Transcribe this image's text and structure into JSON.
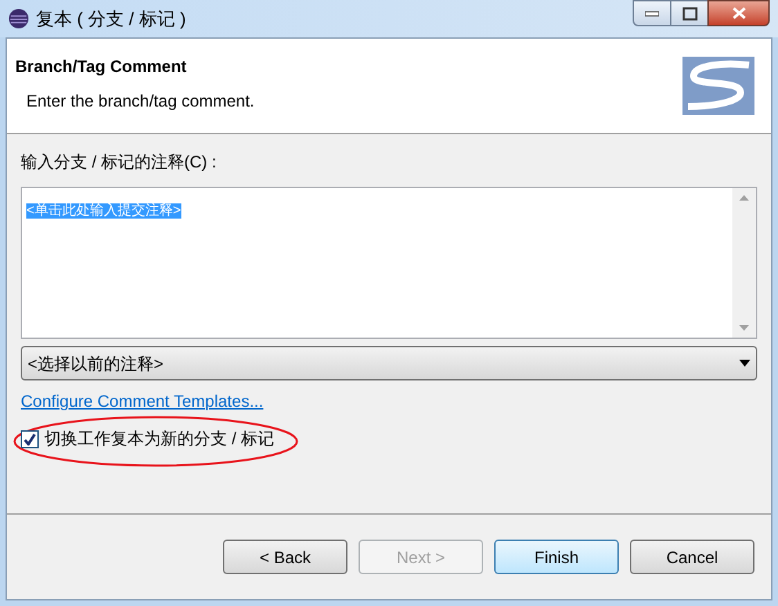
{
  "window": {
    "title": "复本 ( 分支 / 标记 )"
  },
  "header": {
    "title": "Branch/Tag Comment",
    "description": "Enter the branch/tag comment."
  },
  "comment": {
    "label": "输入分支 / 标记的注释(C) :",
    "value": "<单击此处输入提交注释>"
  },
  "previous_comments": {
    "value": "<选择以前的注释>"
  },
  "link": "Configure Comment Templates...",
  "switch_checkbox": {
    "label": "切换工作复本为新的分支 / 标记",
    "checked": true,
    "highlighted": true
  },
  "buttons": [
    {
      "label": "< Back",
      "disabled": false,
      "default": false
    },
    {
      "label": "Next >",
      "disabled": true,
      "default": false
    },
    {
      "label": "Finish",
      "disabled": false,
      "default": true
    },
    {
      "label": "Cancel",
      "disabled": false,
      "default": false
    }
  ]
}
